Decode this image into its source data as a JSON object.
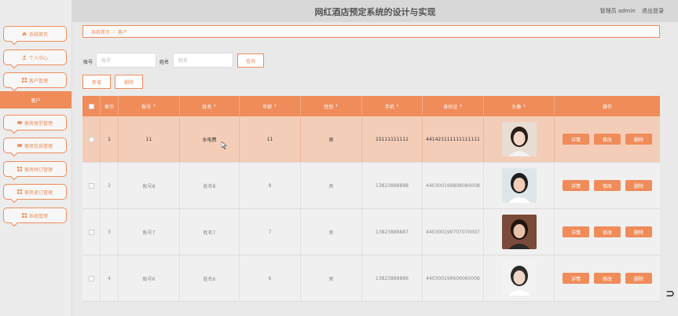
{
  "header": {
    "title": "网红酒店预定系统的设计与实现",
    "user": "管理员 admin",
    "logout": "退出登录"
  },
  "sidebar": {
    "items": [
      {
        "label": "系统首页",
        "icon": "home-icon"
      },
      {
        "label": "个人中心",
        "icon": "user-icon"
      },
      {
        "label": "客户管理",
        "icon": "grid-icon"
      },
      {
        "label": "客房类型管理",
        "icon": "bed-icon"
      },
      {
        "label": "客房信息管理",
        "icon": "bed-icon"
      },
      {
        "label": "客房预订管理",
        "icon": "grid-icon"
      },
      {
        "label": "客房退订管理",
        "icon": "grid-icon"
      },
      {
        "label": "系统管理",
        "icon": "grid-icon"
      }
    ],
    "active_sub": "客户"
  },
  "breadcrumb": {
    "home": "系统首页",
    "sep": "/",
    "current": "客户"
  },
  "search": {
    "account_label": "账号",
    "account_placeholder": "账号",
    "name_label": "姓名",
    "name_placeholder": "姓名",
    "query": "查询"
  },
  "toolbar": {
    "add": "新增",
    "delete": "删除"
  },
  "table": {
    "columns": [
      "",
      "索引",
      "账号",
      "姓名",
      "年龄",
      "性别",
      "手机",
      "身份证",
      "头像",
      "操作"
    ],
    "sortable": [
      false,
      false,
      true,
      true,
      true,
      true,
      true,
      true,
      true,
      false
    ],
    "rows": [
      {
        "index": "1",
        "account": "11",
        "name": "水电费",
        "age": "11",
        "gender": "男",
        "phone": "15111111111",
        "idcard": "441421111111111111",
        "avatar": "girl",
        "active": true
      },
      {
        "index": "2",
        "account": "账号8",
        "name": "姓名8",
        "age": "8",
        "gender": "男",
        "phone": "13823888888",
        "idcard": "440300199808080008",
        "avatar": "boy",
        "active": false
      },
      {
        "index": "3",
        "account": "账号7",
        "name": "姓名7",
        "age": "7",
        "gender": "男",
        "phone": "13823888887",
        "idcard": "440300199707070007",
        "avatar": "girl2",
        "active": false
      },
      {
        "index": "4",
        "account": "账号6",
        "name": "姓名6",
        "age": "6",
        "gender": "男",
        "phone": "13823888886",
        "idcard": "440300199606060006",
        "avatar": "boy2",
        "active": false
      }
    ],
    "actions": {
      "detail": "详情",
      "edit": "修改",
      "delete": "删除"
    }
  },
  "colors": {
    "accent": "#ef8c5a",
    "active_row": "#f4cdb8"
  }
}
